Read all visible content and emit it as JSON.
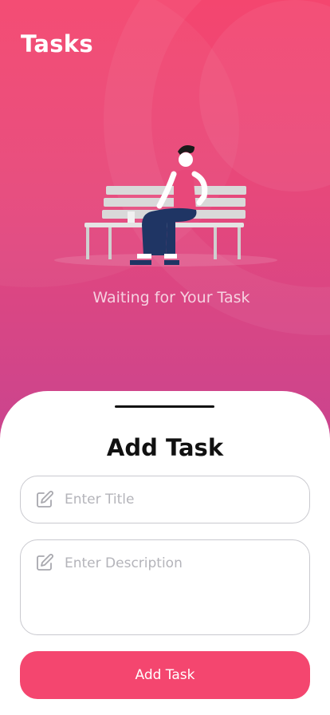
{
  "header": {
    "title": "Tasks"
  },
  "empty_state": {
    "message": "Waiting for Your Task",
    "illustration": "person-on-bench-illustration"
  },
  "sheet": {
    "title": "Add Task",
    "title_field": {
      "placeholder": "Enter Title",
      "icon": "edit-icon",
      "value": ""
    },
    "description_field": {
      "placeholder": "Enter Description",
      "icon": "edit-icon",
      "value": ""
    },
    "submit_label": "Add Task"
  },
  "colors": {
    "accent": "#f4466f",
    "gradient_bottom": "#c9448f"
  }
}
